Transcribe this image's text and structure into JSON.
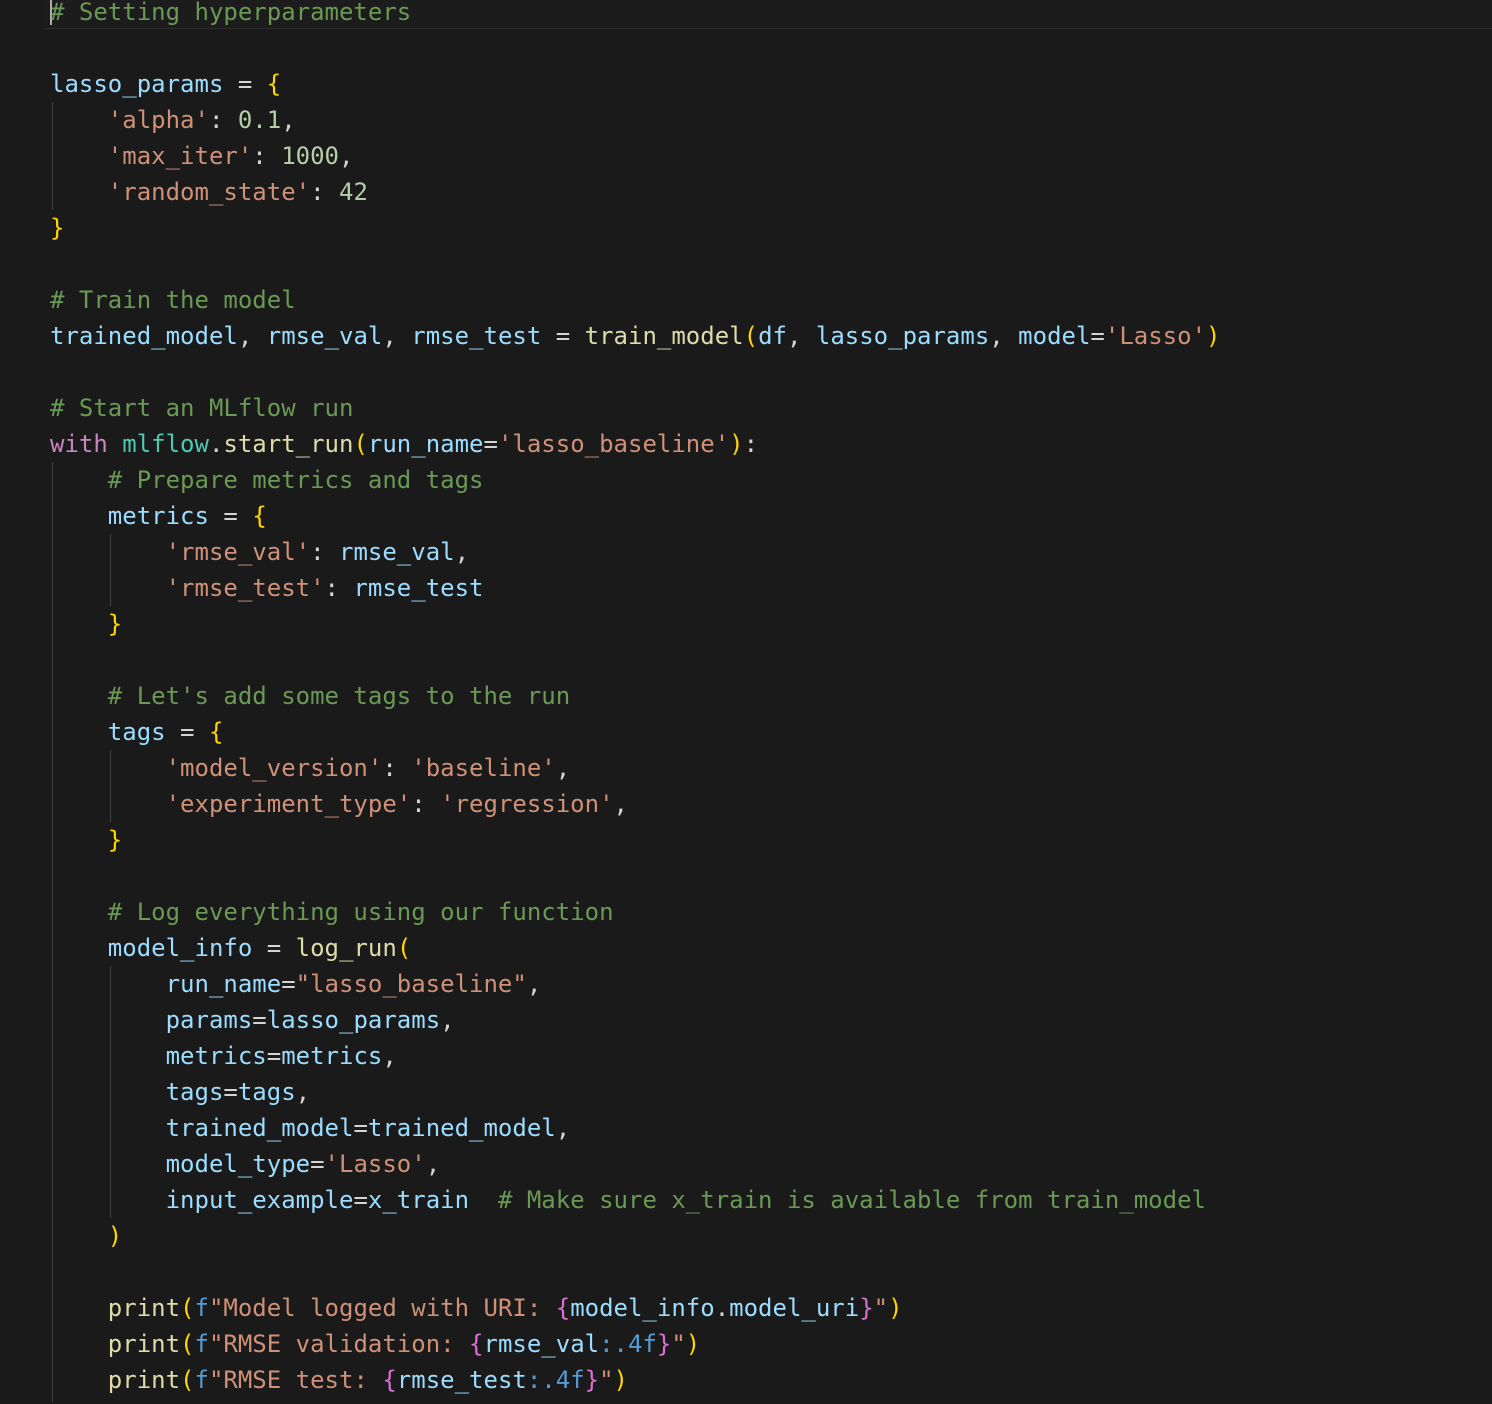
{
  "editor": {
    "lines": [
      [
        {
          "t": "c",
          "x": "# Setting hyperparameters"
        }
      ],
      [],
      [
        {
          "t": "v",
          "x": "lasso_params"
        },
        {
          "t": "o",
          "x": " = "
        },
        {
          "t": "b1",
          "x": "{"
        }
      ],
      [
        {
          "t": "o",
          "x": "    "
        },
        {
          "t": "s",
          "x": "'alpha'"
        },
        {
          "t": "o",
          "x": ": "
        },
        {
          "t": "n",
          "x": "0.1"
        },
        {
          "t": "o",
          "x": ","
        }
      ],
      [
        {
          "t": "o",
          "x": "    "
        },
        {
          "t": "s",
          "x": "'max_iter'"
        },
        {
          "t": "o",
          "x": ": "
        },
        {
          "t": "n",
          "x": "1000"
        },
        {
          "t": "o",
          "x": ","
        }
      ],
      [
        {
          "t": "o",
          "x": "    "
        },
        {
          "t": "s",
          "x": "'random_state'"
        },
        {
          "t": "o",
          "x": ": "
        },
        {
          "t": "n",
          "x": "42"
        }
      ],
      [
        {
          "t": "b1",
          "x": "}"
        }
      ],
      [],
      [
        {
          "t": "c",
          "x": "# Train the model"
        }
      ],
      [
        {
          "t": "v",
          "x": "trained_model"
        },
        {
          "t": "o",
          "x": ", "
        },
        {
          "t": "v",
          "x": "rmse_val"
        },
        {
          "t": "o",
          "x": ", "
        },
        {
          "t": "v",
          "x": "rmse_test"
        },
        {
          "t": "o",
          "x": " = "
        },
        {
          "t": "f",
          "x": "train_model"
        },
        {
          "t": "b1",
          "x": "("
        },
        {
          "t": "v",
          "x": "df"
        },
        {
          "t": "o",
          "x": ", "
        },
        {
          "t": "v",
          "x": "lasso_params"
        },
        {
          "t": "o",
          "x": ", "
        },
        {
          "t": "v",
          "x": "model"
        },
        {
          "t": "o",
          "x": "="
        },
        {
          "t": "s",
          "x": "'Lasso'"
        },
        {
          "t": "b1",
          "x": ")"
        }
      ],
      [],
      [
        {
          "t": "c",
          "x": "# Start an MLflow run"
        }
      ],
      [
        {
          "t": "k",
          "x": "with"
        },
        {
          "t": "o",
          "x": " "
        },
        {
          "t": "m",
          "x": "mlflow"
        },
        {
          "t": "o",
          "x": "."
        },
        {
          "t": "f",
          "x": "start_run"
        },
        {
          "t": "b1",
          "x": "("
        },
        {
          "t": "v",
          "x": "run_name"
        },
        {
          "t": "o",
          "x": "="
        },
        {
          "t": "s",
          "x": "'lasso_baseline'"
        },
        {
          "t": "b1",
          "x": ")"
        },
        {
          "t": "o",
          "x": ":"
        }
      ],
      [
        {
          "t": "o",
          "x": "    "
        },
        {
          "t": "c",
          "x": "# Prepare metrics and tags"
        }
      ],
      [
        {
          "t": "o",
          "x": "    "
        },
        {
          "t": "v",
          "x": "metrics"
        },
        {
          "t": "o",
          "x": " = "
        },
        {
          "t": "b1",
          "x": "{"
        }
      ],
      [
        {
          "t": "o",
          "x": "        "
        },
        {
          "t": "s",
          "x": "'rmse_val'"
        },
        {
          "t": "o",
          "x": ": "
        },
        {
          "t": "v",
          "x": "rmse_val"
        },
        {
          "t": "o",
          "x": ","
        }
      ],
      [
        {
          "t": "o",
          "x": "        "
        },
        {
          "t": "s",
          "x": "'rmse_test'"
        },
        {
          "t": "o",
          "x": ": "
        },
        {
          "t": "v",
          "x": "rmse_test"
        }
      ],
      [
        {
          "t": "o",
          "x": "    "
        },
        {
          "t": "b1",
          "x": "}"
        }
      ],
      [],
      [
        {
          "t": "o",
          "x": "    "
        },
        {
          "t": "c",
          "x": "# Let's add some tags to the run"
        }
      ],
      [
        {
          "t": "o",
          "x": "    "
        },
        {
          "t": "v",
          "x": "tags"
        },
        {
          "t": "o",
          "x": " = "
        },
        {
          "t": "b1",
          "x": "{"
        }
      ],
      [
        {
          "t": "o",
          "x": "        "
        },
        {
          "t": "s",
          "x": "'model_version'"
        },
        {
          "t": "o",
          "x": ": "
        },
        {
          "t": "s",
          "x": "'baseline'"
        },
        {
          "t": "o",
          "x": ","
        }
      ],
      [
        {
          "t": "o",
          "x": "        "
        },
        {
          "t": "s",
          "x": "'experiment_type'"
        },
        {
          "t": "o",
          "x": ": "
        },
        {
          "t": "s",
          "x": "'regression'"
        },
        {
          "t": "o",
          "x": ","
        }
      ],
      [
        {
          "t": "o",
          "x": "    "
        },
        {
          "t": "b1",
          "x": "}"
        }
      ],
      [],
      [
        {
          "t": "o",
          "x": "    "
        },
        {
          "t": "c",
          "x": "# Log everything using our function"
        }
      ],
      [
        {
          "t": "o",
          "x": "    "
        },
        {
          "t": "v",
          "x": "model_info"
        },
        {
          "t": "o",
          "x": " = "
        },
        {
          "t": "f",
          "x": "log_run"
        },
        {
          "t": "b1",
          "x": "("
        }
      ],
      [
        {
          "t": "o",
          "x": "        "
        },
        {
          "t": "v",
          "x": "run_name"
        },
        {
          "t": "o",
          "x": "="
        },
        {
          "t": "s",
          "x": "\"lasso_baseline\""
        },
        {
          "t": "o",
          "x": ","
        }
      ],
      [
        {
          "t": "o",
          "x": "        "
        },
        {
          "t": "v",
          "x": "params"
        },
        {
          "t": "o",
          "x": "="
        },
        {
          "t": "v",
          "x": "lasso_params"
        },
        {
          "t": "o",
          "x": ","
        }
      ],
      [
        {
          "t": "o",
          "x": "        "
        },
        {
          "t": "v",
          "x": "metrics"
        },
        {
          "t": "o",
          "x": "="
        },
        {
          "t": "v",
          "x": "metrics"
        },
        {
          "t": "o",
          "x": ","
        }
      ],
      [
        {
          "t": "o",
          "x": "        "
        },
        {
          "t": "v",
          "x": "tags"
        },
        {
          "t": "o",
          "x": "="
        },
        {
          "t": "v",
          "x": "tags"
        },
        {
          "t": "o",
          "x": ","
        }
      ],
      [
        {
          "t": "o",
          "x": "        "
        },
        {
          "t": "v",
          "x": "trained_model"
        },
        {
          "t": "o",
          "x": "="
        },
        {
          "t": "v",
          "x": "trained_model"
        },
        {
          "t": "o",
          "x": ","
        }
      ],
      [
        {
          "t": "o",
          "x": "        "
        },
        {
          "t": "v",
          "x": "model_type"
        },
        {
          "t": "o",
          "x": "="
        },
        {
          "t": "s",
          "x": "'Lasso'"
        },
        {
          "t": "o",
          "x": ","
        }
      ],
      [
        {
          "t": "o",
          "x": "        "
        },
        {
          "t": "v",
          "x": "input_example"
        },
        {
          "t": "o",
          "x": "="
        },
        {
          "t": "v",
          "x": "x_train"
        },
        {
          "t": "o",
          "x": "  "
        },
        {
          "t": "c",
          "x": "# Make sure x_train is available from train_model"
        }
      ],
      [
        {
          "t": "o",
          "x": "    "
        },
        {
          "t": "b1",
          "x": ")"
        }
      ],
      [],
      [
        {
          "t": "o",
          "x": "    "
        },
        {
          "t": "f",
          "x": "print"
        },
        {
          "t": "b1",
          "x": "("
        },
        {
          "t": "st",
          "x": "f"
        },
        {
          "t": "s",
          "x": "\"Model logged with URI: "
        },
        {
          "t": "b2",
          "x": "{"
        },
        {
          "t": "v",
          "x": "model_info"
        },
        {
          "t": "o",
          "x": "."
        },
        {
          "t": "v",
          "x": "model_uri"
        },
        {
          "t": "b2",
          "x": "}"
        },
        {
          "t": "s",
          "x": "\""
        },
        {
          "t": "b1",
          "x": ")"
        }
      ],
      [
        {
          "t": "o",
          "x": "    "
        },
        {
          "t": "f",
          "x": "print"
        },
        {
          "t": "b1",
          "x": "("
        },
        {
          "t": "st",
          "x": "f"
        },
        {
          "t": "s",
          "x": "\"RMSE validation: "
        },
        {
          "t": "b2",
          "x": "{"
        },
        {
          "t": "v",
          "x": "rmse_val"
        },
        {
          "t": "st",
          "x": ":.4f"
        },
        {
          "t": "b2",
          "x": "}"
        },
        {
          "t": "s",
          "x": "\""
        },
        {
          "t": "b1",
          "x": ")"
        }
      ],
      [
        {
          "t": "o",
          "x": "    "
        },
        {
          "t": "f",
          "x": "print"
        },
        {
          "t": "b1",
          "x": "("
        },
        {
          "t": "st",
          "x": "f"
        },
        {
          "t": "s",
          "x": "\"RMSE test: "
        },
        {
          "t": "b2",
          "x": "{"
        },
        {
          "t": "v",
          "x": "rmse_test"
        },
        {
          "t": "st",
          "x": ":.4f"
        },
        {
          "t": "b2",
          "x": "}"
        },
        {
          "t": "s",
          "x": "\""
        },
        {
          "t": "b1",
          "x": ")"
        }
      ]
    ]
  }
}
